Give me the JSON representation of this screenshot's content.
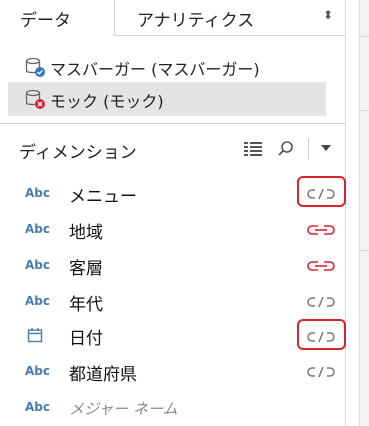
{
  "tabs": {
    "data_label": "データ",
    "analytics_label": "アナリティクス",
    "analytics_arrows": "⬍"
  },
  "datasources": [
    {
      "label": "マスバーガー (マスバーガー)",
      "status": "ok",
      "status_color": "#2e79b9"
    },
    {
      "label": "モック (モック)",
      "status": "error",
      "status_color": "#d9232b"
    }
  ],
  "dimensions": {
    "header": "ディメンション",
    "fields": [
      {
        "type": "Abc",
        "name": "メニュー",
        "link": "broken",
        "highlighted": true
      },
      {
        "type": "Abc",
        "name": "地域",
        "link": "active"
      },
      {
        "type": "Abc",
        "name": "客層",
        "link": "active"
      },
      {
        "type": "Abc",
        "name": "年代",
        "link": "broken"
      },
      {
        "type": "date",
        "name": "日付",
        "link": "broken",
        "highlighted": true
      },
      {
        "type": "Abc",
        "name": "都道府県",
        "link": "broken"
      },
      {
        "type": "Abc",
        "name": "メジャー ネーム",
        "link": "none",
        "italic": true
      }
    ]
  },
  "colors": {
    "accent_blue": "#4a7cad",
    "link_active": "#d9232b",
    "link_broken": "#777777",
    "highlight": "#d9232b"
  }
}
